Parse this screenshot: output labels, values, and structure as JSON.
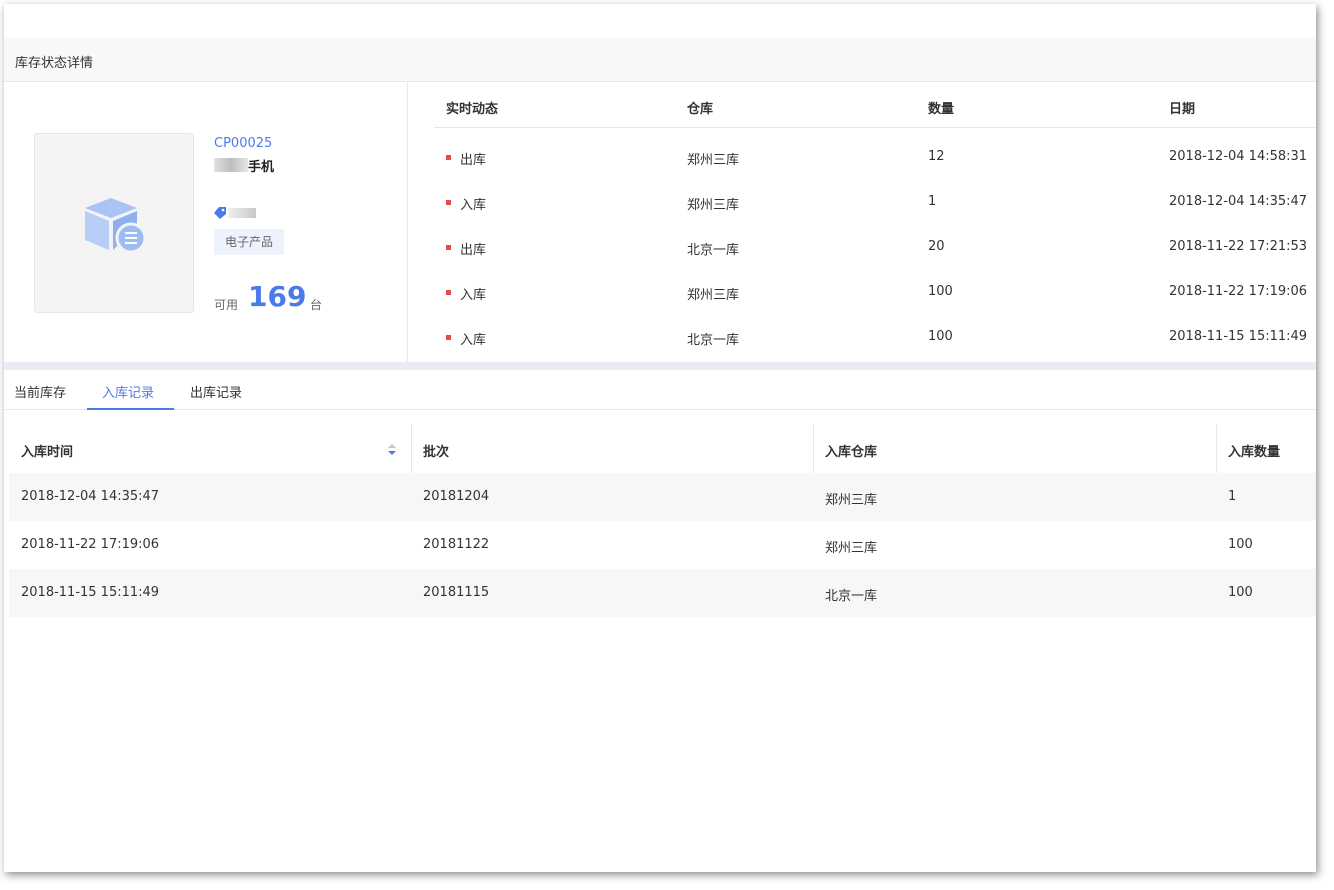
{
  "header": {
    "title": "库存状态详情"
  },
  "product": {
    "code": "CP00025",
    "name": "手机",
    "category": "电子产品",
    "available_label": "可用",
    "available_count": "169",
    "unit": "台"
  },
  "activity": {
    "columns": [
      "实时动态",
      "仓库",
      "数量",
      "日期"
    ],
    "rows": [
      {
        "type": "出库",
        "warehouse": "郑州三库",
        "qty": "12",
        "date": "2018-12-04 14:58:31"
      },
      {
        "type": "入库",
        "warehouse": "郑州三库",
        "qty": "1",
        "date": "2018-12-04 14:35:47"
      },
      {
        "type": "出库",
        "warehouse": "北京一库",
        "qty": "20",
        "date": "2018-11-22 17:21:53"
      },
      {
        "type": "入库",
        "warehouse": "郑州三库",
        "qty": "100",
        "date": "2018-11-22 17:19:06"
      },
      {
        "type": "入库",
        "warehouse": "北京一库",
        "qty": "100",
        "date": "2018-11-15 15:11:49"
      }
    ]
  },
  "tabs": [
    {
      "label": "当前库存",
      "active": false
    },
    {
      "label": "入库记录",
      "active": true
    },
    {
      "label": "出库记录",
      "active": false
    }
  ],
  "records": {
    "columns": [
      "入库时间",
      "批次",
      "入库仓库",
      "入库数量"
    ],
    "rows": [
      {
        "time": "2018-12-04 14:35:47",
        "batch": "20181204",
        "warehouse": "郑州三库",
        "qty": "1"
      },
      {
        "time": "2018-11-22 17:19:06",
        "batch": "20181122",
        "warehouse": "郑州三库",
        "qty": "100"
      },
      {
        "time": "2018-11-15 15:11:49",
        "batch": "20181115",
        "warehouse": "北京一库",
        "qty": "100"
      }
    ]
  },
  "colors": {
    "accent": "#4a7be8",
    "outbound_dot": "#e64a4a",
    "tag_bg": "#edf2fc"
  }
}
